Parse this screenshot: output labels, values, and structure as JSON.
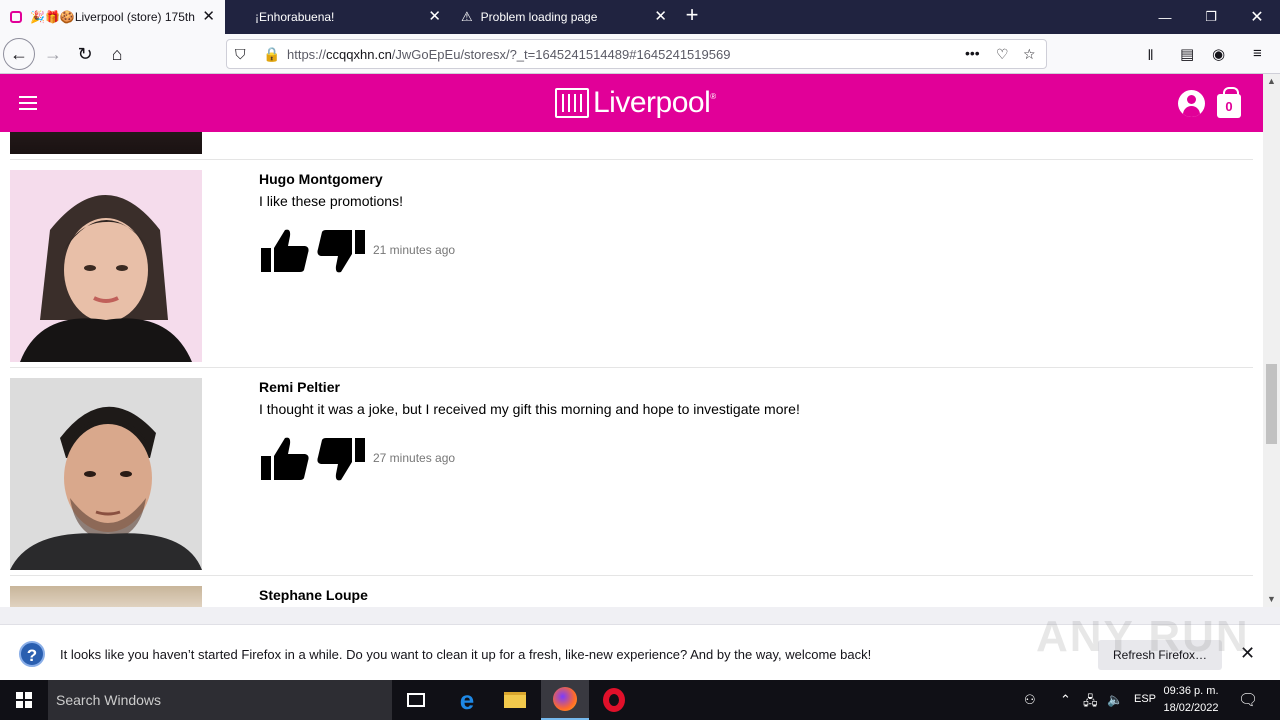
{
  "browser": {
    "tabs": [
      {
        "title": "🎉🎁🍪Liverpool (store) 175th",
        "close": "✕"
      },
      {
        "title": "¡Enhorabuena!",
        "close": "✕"
      },
      {
        "title": "Problem loading page",
        "close": "✕"
      }
    ],
    "new_tab": "+",
    "url_prefix": "https://",
    "url_domain": "ccqqxhn.cn",
    "url_path": "/JwGoEpEu/storesx/?_t=1645241514489#1645241519569",
    "url_more": "•••"
  },
  "site": {
    "logo_text": "Liverpool",
    "logo_reg": "®",
    "cart_count": "0"
  },
  "comments": [
    {
      "name": "Hugo Montgomery",
      "text": "I like these promotions!",
      "time": "21 minutes ago"
    },
    {
      "name": "Remi Peltier",
      "text": "I thought it was a joke, but I received my gift this morning and hope to investigate more!",
      "time": "27 minutes ago"
    },
    {
      "name": "Stephane Loupe",
      "text": "",
      "time": ""
    }
  ],
  "notification": {
    "text": "It looks like you haven’t started Firefox in a while. Do you want to clean it up for a fresh, like-new experience? And by the way, welcome back!",
    "button": "Refresh Firefox…",
    "close": "✕"
  },
  "watermark": "ANY RUN",
  "taskbar": {
    "search_placeholder": "Search Windows",
    "language": "ESP",
    "time": "09:36 p. m.",
    "date": "18/02/2022"
  },
  "colors": {
    "brand_pink": "#e10098",
    "tabstrip": "#202340"
  }
}
